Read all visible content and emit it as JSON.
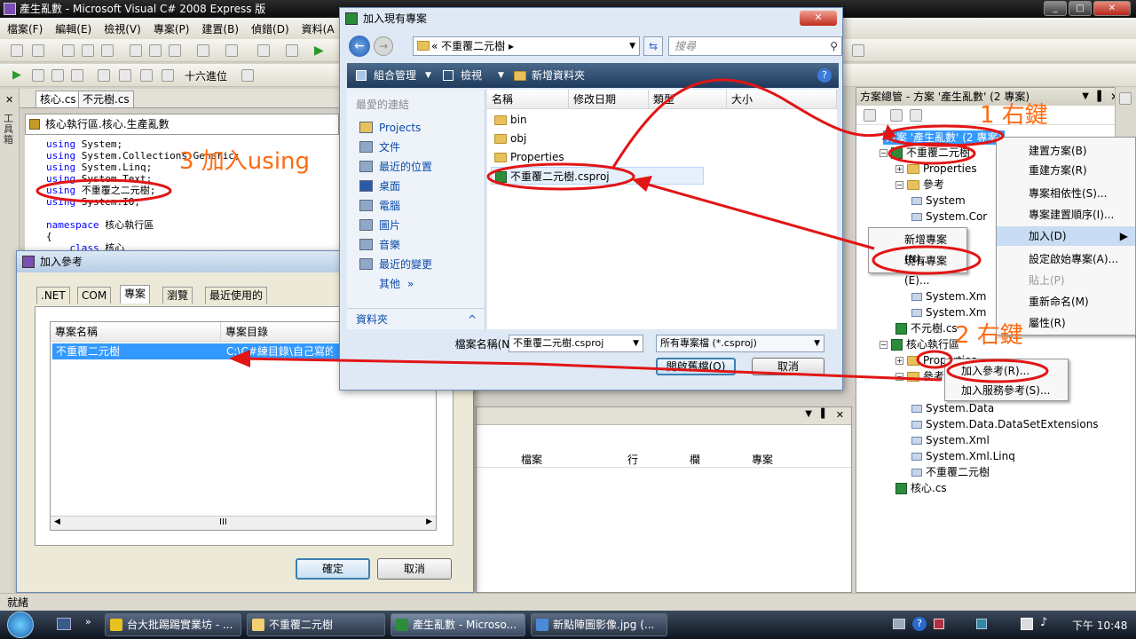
{
  "window": {
    "title": "產生亂數 - Microsoft Visual C# 2008 Express 版",
    "min": "_",
    "max": "□",
    "close": "✕"
  },
  "menu": [
    "檔案(F)",
    "編輯(E)",
    "檢視(V)",
    "專案(P)",
    "建置(B)",
    "偵錯(D)",
    "資料(A"
  ],
  "toolbar2": {
    "hex_label": "十六進位"
  },
  "left_strip": {
    "toolbox_label": "工具箱"
  },
  "editor": {
    "tabs": [
      "核心.cs",
      "不元樹.cs"
    ],
    "nav_path": "核心執行區.核心.生產亂數",
    "lines": [
      {
        "kw": "using",
        "rest": " System;"
      },
      {
        "kw": "using",
        "rest": " System.Collections.Generic;"
      },
      {
        "kw": "using",
        "rest": " System.Linq;"
      },
      {
        "kw": "using",
        "rest": " System.Text;"
      },
      {
        "kw": "using",
        "rest": " 不重覆之二元樹;"
      },
      {
        "kw": "using",
        "rest": " System.IO;"
      },
      {
        "kw": "",
        "rest": ""
      },
      {
        "kw": "namespace",
        "rest": " 核心執行區"
      },
      {
        "kw": "",
        "rest": "{"
      },
      {
        "kw": "    class",
        "rest": " 核心"
      }
    ]
  },
  "add_ref": {
    "title": "加入參考",
    "tabs": [
      ".NET",
      "COM",
      "專案",
      "瀏覽",
      "最近使用的"
    ],
    "col_name": "專案名稱",
    "col_dir": "專案目錄",
    "row_name": "不重覆二元樹",
    "row_dir": "C:\\C#練目錄\\自己寫的程",
    "ok": "確定",
    "cancel": "取消",
    "scroll_mid": "III"
  },
  "open_dlg": {
    "title": "加入現有專案",
    "breadcrumb": "«  不重覆二元樹  ▸",
    "search_placeholder": "搜尋",
    "cmd_organize": "組合管理",
    "cmd_view": "檢視",
    "cmd_newfolder": "新增資料夾",
    "help": "?",
    "favorites_hdr": "最愛的連結",
    "nav": [
      "Projects",
      "文件",
      "最近的位置",
      "桌面",
      "電腦",
      "圖片",
      "音樂",
      "最近的變更",
      "其他"
    ],
    "nav_more": "»",
    "folders_label": "資料夾",
    "folders_chev": "^",
    "cols": [
      "名稱",
      "修改日期",
      "類型",
      "大小"
    ],
    "files": [
      {
        "name": "bin",
        "type": "folder"
      },
      {
        "name": "obj",
        "type": "folder"
      },
      {
        "name": "Properties",
        "type": "folder"
      },
      {
        "name": "不重覆二元樹.csproj",
        "type": "csproj"
      }
    ],
    "filename_label": "檔案名稱(N):",
    "filename_value": "不重覆二元樹.csproj",
    "filter_value": "所有專案檔 (*.csproj)",
    "open": "開啟舊檔(O)",
    "cancel": "取消"
  },
  "output_panel": {
    "cols": [
      "檔案",
      "行",
      "欄",
      "專案"
    ]
  },
  "solution": {
    "title": "方案總管 - 方案 '產生亂數' (2 專案)",
    "root": "方案 '產生亂數' (2 專案)",
    "items": [
      {
        "label": "不重覆二元樹",
        "kind": "proj",
        "indent": 1
      },
      {
        "label": "Properties",
        "kind": "folder",
        "indent": 2
      },
      {
        "label": "參考",
        "kind": "folder",
        "indent": 2
      },
      {
        "label": "System",
        "kind": "ref",
        "indent": 3
      },
      {
        "label": "System.Cor",
        "kind": "ref",
        "indent": 3
      },
      {
        "label": "System.Xm",
        "kind": "ref",
        "indent": 3
      },
      {
        "label": "System.Xm",
        "kind": "ref",
        "indent": 3
      },
      {
        "label": "不元樹.cs",
        "kind": "cs",
        "indent": 2
      },
      {
        "label": "核心執行區",
        "kind": "proj",
        "indent": 1
      },
      {
        "label": "Properties",
        "kind": "folder",
        "indent": 2
      },
      {
        "label": "參考",
        "kind": "folder",
        "indent": 2
      },
      {
        "label": "System.Data",
        "kind": "ref",
        "indent": 3
      },
      {
        "label": "System.Data.DataSetExtensions",
        "kind": "ref",
        "indent": 3
      },
      {
        "label": "System.Xml",
        "kind": "ref",
        "indent": 3
      },
      {
        "label": "System.Xml.Linq",
        "kind": "ref",
        "indent": 3
      },
      {
        "label": "不重覆二元樹",
        "kind": "ref",
        "indent": 3
      },
      {
        "label": "核心.cs",
        "kind": "cs",
        "indent": 2
      }
    ]
  },
  "ctx_solution": [
    "建置方案(B)",
    "重建方案(R)",
    "專案相依性(S)...",
    "專案建置順序(I)...",
    "加入(D)",
    "設定啟始專案(A)...",
    "貼上(P)",
    "重新命名(M)",
    "屬性(R)"
  ],
  "ctx_add_sub": [
    "新增專案(N)...",
    "現有專案(E)..."
  ],
  "ctx_ref": [
    "加入參考(R)...",
    "加入服務參考(S)..."
  ],
  "annotations": {
    "a1": "1 右鍵",
    "a2": "2 右鍵",
    "a3": "3 加入using"
  },
  "status": "就緒",
  "taskbar": {
    "items": [
      "台大批踢踢實業坊 - ...",
      "不重覆二元樹",
      "產生亂數 - Microso...",
      "新點陣圖影像.jpg (..."
    ],
    "clock": "下午 10:48",
    "more": "»"
  },
  "colors": {
    "annot": "#ff6a10",
    "circle": "#e21515",
    "select": "#3399ff"
  }
}
